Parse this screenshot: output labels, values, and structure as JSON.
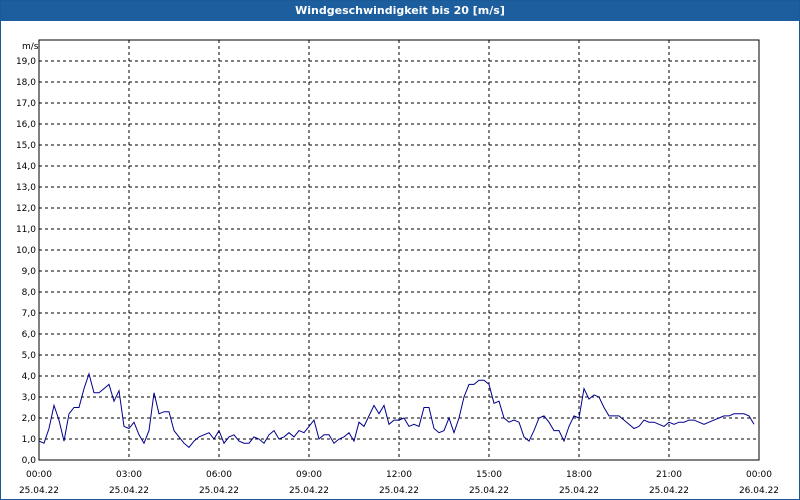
{
  "window": {
    "title": "Windgeschwindigkeit bis 20 [m/s]"
  },
  "colors": {
    "titlebar": "#1d5f9e",
    "line": "#00008b",
    "grid": "#000000"
  },
  "chart_data": {
    "type": "line",
    "title": "Windgeschwindigkeit bis 20 [m/s]",
    "ylabel": "m/s",
    "ylim": [
      0,
      20
    ],
    "xlim_hours": [
      0,
      24
    ],
    "grid": true,
    "yticks": [
      "0,0",
      "1,0",
      "2,0",
      "3,0",
      "4,0",
      "5,0",
      "6,0",
      "7,0",
      "8,0",
      "9,0",
      "10,0",
      "11,0",
      "12,0",
      "13,0",
      "14,0",
      "15,0",
      "16,0",
      "17,0",
      "18,0",
      "19,0"
    ],
    "xticks": [
      {
        "time": "00:00",
        "date": "25.04.22"
      },
      {
        "time": "03:00",
        "date": "25.04.22"
      },
      {
        "time": "06:00",
        "date": "25.04.22"
      },
      {
        "time": "09:00",
        "date": "25.04.22"
      },
      {
        "time": "12:00",
        "date": "25.04.22"
      },
      {
        "time": "15:00",
        "date": "25.04.22"
      },
      {
        "time": "18:00",
        "date": "25.04.22"
      },
      {
        "time": "21:00",
        "date": "25.04.22"
      },
      {
        "time": "00:00",
        "date": "26.04.22"
      }
    ],
    "series": [
      {
        "x": [
          "00:00",
          "00:10",
          "00:20",
          "00:30",
          "00:40",
          "00:50",
          "01:00",
          "01:10",
          "01:20",
          "01:30",
          "01:40",
          "01:50",
          "02:00",
          "02:10",
          "02:20",
          "02:30",
          "02:40",
          "02:50",
          "03:00",
          "03:10",
          "03:20",
          "03:30",
          "03:40",
          "03:50",
          "04:00",
          "04:10",
          "04:20",
          "04:30",
          "04:40",
          "04:50",
          "05:00",
          "05:10",
          "05:20",
          "05:30",
          "05:40",
          "05:50",
          "06:00",
          "06:10",
          "06:20",
          "06:30",
          "06:40",
          "06:50",
          "07:00",
          "07:10",
          "07:20",
          "07:30",
          "07:40",
          "07:50",
          "08:00",
          "08:10",
          "08:20",
          "08:30",
          "08:40",
          "08:50",
          "09:00",
          "09:10",
          "09:20",
          "09:30",
          "09:40",
          "09:50",
          "10:00",
          "10:10",
          "10:20",
          "10:30",
          "10:40",
          "10:50",
          "11:00",
          "11:10",
          "11:20",
          "11:30",
          "11:40",
          "11:50",
          "12:00",
          "12:10",
          "12:20",
          "12:30",
          "12:40",
          "12:50",
          "13:00",
          "13:10",
          "13:20",
          "13:30",
          "13:40",
          "13:50",
          "14:00",
          "14:10",
          "14:20",
          "14:30",
          "14:40",
          "14:50",
          "15:00",
          "15:10",
          "15:20",
          "15:30",
          "15:40",
          "15:50",
          "16:00",
          "16:10",
          "16:20",
          "16:30",
          "16:40",
          "16:50",
          "17:00",
          "17:10",
          "17:20",
          "17:30",
          "17:40",
          "17:50",
          "18:00",
          "18:10",
          "18:20",
          "18:30",
          "18:40",
          "18:50",
          "19:00",
          "19:10",
          "19:20",
          "19:30",
          "19:40",
          "19:50",
          "20:00",
          "20:10",
          "20:20",
          "20:30",
          "20:40",
          "20:50",
          "21:00",
          "21:10",
          "21:20",
          "21:30",
          "21:40",
          "21:50",
          "22:00",
          "22:10",
          "22:20",
          "22:30",
          "22:40",
          "22:50",
          "23:00",
          "23:10",
          "23:20",
          "23:30",
          "23:40",
          "23:50"
        ],
        "values": [
          0.9,
          0.8,
          1.5,
          2.6,
          1.9,
          0.9,
          2.2,
          2.5,
          2.5,
          3.4,
          4.1,
          3.2,
          3.2,
          3.4,
          3.6,
          2.8,
          3.3,
          1.6,
          1.5,
          1.8,
          1.2,
          0.8,
          1.4,
          3.2,
          2.2,
          2.3,
          2.3,
          1.4,
          1.1,
          0.8,
          0.6,
          0.9,
          1.1,
          1.2,
          1.3,
          1.0,
          1.4,
          0.8,
          1.1,
          1.2,
          0.9,
          0.8,
          0.8,
          1.1,
          1.0,
          0.8,
          1.2,
          1.4,
          1.0,
          1.1,
          1.3,
          1.1,
          1.4,
          1.3,
          1.6,
          1.9,
          1.0,
          1.2,
          1.2,
          0.8,
          1.0,
          1.1,
          1.3,
          0.9,
          1.8,
          1.6,
          2.1,
          2.6,
          2.2,
          2.6,
          1.7,
          1.9,
          1.9,
          2.0,
          1.6,
          1.7,
          1.6,
          2.5,
          2.5,
          1.5,
          1.3,
          1.4,
          2.0,
          1.3,
          2.0,
          3.0,
          3.6,
          3.6,
          3.8,
          3.8,
          3.6,
          2.7,
          2.8,
          2.0,
          1.8,
          1.9,
          1.8,
          1.1,
          0.9,
          1.4,
          2.0,
          2.1,
          1.8,
          1.4,
          1.4,
          0.9,
          1.6,
          2.1,
          2.0,
          3.4,
          2.9,
          3.1,
          3.0,
          2.5,
          2.1,
          2.1,
          2.1,
          1.9,
          1.7,
          1.5,
          1.6,
          1.9,
          1.8,
          1.8,
          1.7,
          1.6,
          1.8,
          1.7,
          1.8,
          1.8,
          1.9,
          1.9,
          1.8,
          1.7,
          1.8,
          1.9,
          2.0,
          2.1,
          2.1,
          2.2,
          2.2,
          2.2,
          2.1,
          1.7
        ]
      }
    ]
  }
}
